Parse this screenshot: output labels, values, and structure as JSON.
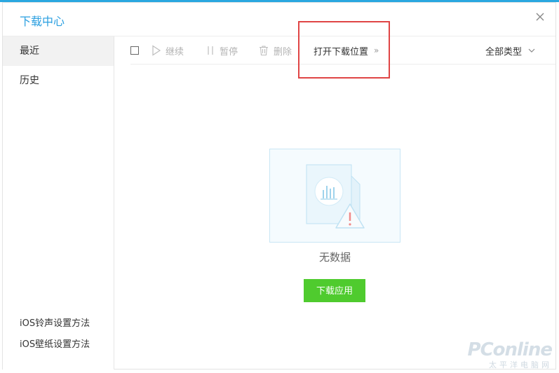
{
  "window": {
    "title": "下载中心"
  },
  "sidebar": {
    "items": [
      {
        "label": "最近",
        "active": true
      },
      {
        "label": "历史",
        "active": false
      }
    ],
    "links": [
      {
        "label": "iOS铃声设置方法"
      },
      {
        "label": "iOS壁纸设置方法"
      }
    ]
  },
  "toolbar": {
    "continue_label": "继续",
    "pause_label": "暂停",
    "delete_label": "删除",
    "open_location_label": "打开下载位置",
    "open_location_arrows": "»",
    "filter_label": "全部类型"
  },
  "empty": {
    "message": "无数据",
    "button_label": "下载应用"
  },
  "watermark": {
    "brand": "PConline",
    "sub": "太平洋电脑网"
  },
  "colors": {
    "accent": "#2aa7e0",
    "button": "#4fcb2e",
    "highlight": "#e04545"
  }
}
